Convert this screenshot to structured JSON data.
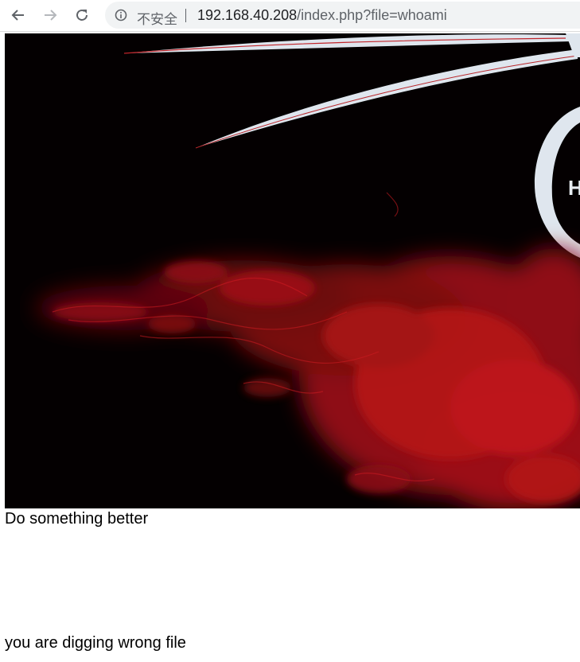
{
  "browser": {
    "back_icon": "arrow-left-icon",
    "forward_icon": "arrow-right-icon",
    "reload_icon": "reload-icon",
    "security_icon": "info-circle-icon",
    "security_label": "不安全",
    "url_host": "192.168.40.208",
    "url_path": "/index.php?file=whoami"
  },
  "page": {
    "hero_image": "dark-red-smoke-dragon-artwork",
    "hero_letter": "H",
    "message_top": "Do something better",
    "message_bottom": "you are digging wrong file"
  },
  "colors": {
    "hero_background": "#040001",
    "smoke_red": "#b01016",
    "swoosh": "#dfe6ee"
  }
}
